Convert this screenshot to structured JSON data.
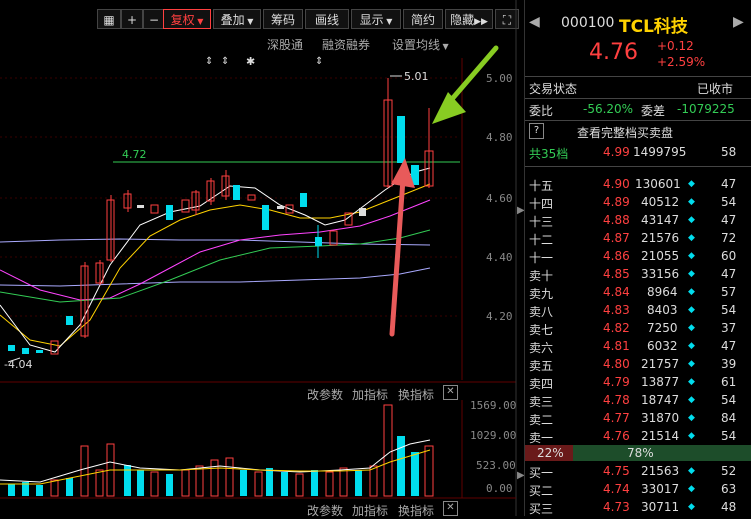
{
  "toolbar": {
    "fq": "复权",
    "overlay": "叠加",
    "chips": "筹码",
    "draw": "画线",
    "display": "显示",
    "simple": "简约",
    "hide": "隐藏"
  },
  "links": {
    "sgt": "深股通",
    "margin": "融资融券",
    "set_ma": "设置均线"
  },
  "axis": {
    "p500": "5.00",
    "p480": "4.80",
    "p460": "4.60",
    "p440": "4.40",
    "p420": "4.20"
  },
  "labels": {
    "hi": "5.01",
    "lo": "4.04",
    "level": "4.72"
  },
  "indicator_bar": {
    "params": "改参数",
    "add": "加指标",
    "swap": "换指标"
  },
  "vol_axis": {
    "v1": "1569.00",
    "v2": "1029.00",
    "v3": "523.00",
    "v4": "0.00"
  },
  "quote": {
    "code": "000100",
    "name": "TCL科技",
    "price": "4.76",
    "change": "+0.12",
    "change_pct": "+2.59%",
    "state_label": "交易状态",
    "state": "已收市",
    "wb_label": "委比",
    "wb": "-56.20%",
    "wc_label": "委差",
    "wc": "-1079225",
    "full_depth": "查看完整档买卖盘",
    "total_label": "共35档",
    "total_price": "4.99",
    "total_vol": "1499795",
    "total_n": "58"
  },
  "asks": [
    {
      "label": "十五",
      "price": "4.90",
      "vol": "130601",
      "n": "47"
    },
    {
      "label": "十四",
      "price": "4.89",
      "vol": "40512",
      "n": "54"
    },
    {
      "label": "十三",
      "price": "4.88",
      "vol": "43147",
      "n": "47"
    },
    {
      "label": "十二",
      "price": "4.87",
      "vol": "21576",
      "n": "72"
    },
    {
      "label": "十一",
      "price": "4.86",
      "vol": "21055",
      "n": "60"
    },
    {
      "label": "卖十",
      "price": "4.85",
      "vol": "33156",
      "n": "47"
    },
    {
      "label": "卖九",
      "price": "4.84",
      "vol": "8964",
      "n": "57"
    },
    {
      "label": "卖八",
      "price": "4.83",
      "vol": "8403",
      "n": "54"
    },
    {
      "label": "卖七",
      "price": "4.82",
      "vol": "7250",
      "n": "37"
    },
    {
      "label": "卖六",
      "price": "4.81",
      "vol": "6032",
      "n": "47"
    },
    {
      "label": "卖五",
      "price": "4.80",
      "vol": "21757",
      "n": "39"
    },
    {
      "label": "卖四",
      "price": "4.79",
      "vol": "13877",
      "n": "61"
    },
    {
      "label": "卖三",
      "price": "4.78",
      "vol": "18747",
      "n": "54"
    },
    {
      "label": "卖二",
      "price": "4.77",
      "vol": "31870",
      "n": "84"
    },
    {
      "label": "卖一",
      "price": "4.76",
      "vol": "21514",
      "n": "54"
    }
  ],
  "ratio": {
    "left": "22%",
    "right": "78%"
  },
  "bids": [
    {
      "label": "买一",
      "price": "4.75",
      "vol": "21563",
      "n": "52"
    },
    {
      "label": "买二",
      "price": "4.74",
      "vol": "33017",
      "n": "63"
    },
    {
      "label": "买三",
      "price": "4.73",
      "vol": "30711",
      "n": "48"
    }
  ],
  "colors": {
    "up": "#ff4040",
    "down": "#00ddee",
    "ma5": "#ffffff",
    "ma10": "#ffd200",
    "ma20": "#ff44ff",
    "ma30": "#33cc55",
    "ma60": "#aaaaff"
  }
}
